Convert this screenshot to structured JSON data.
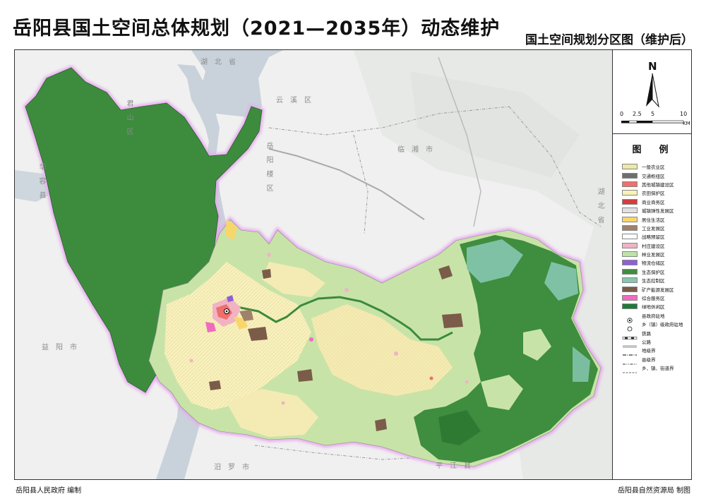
{
  "header": {
    "title": "岳阳县国土空间总体规划（2021—2035年）动态维护",
    "subtitle": "国土空间规划分区图（维护后）"
  },
  "map": {
    "place_labels": [
      "湖　北　省",
      "君　山　区",
      "华　容　县",
      "云　溪　区",
      "岳　阳　楼　区",
      "临　湘　市",
      "湖　北　省",
      "益　阳　市",
      "汨　罗　市",
      "平　江　县"
    ],
    "colors": {
      "water": "#c9d2da",
      "basemap": "#f0f0f0",
      "eco_protection": "#3d8c3e",
      "forest": "#c8e3a8",
      "farmland": "#f7f1bf"
    }
  },
  "compass": {
    "north_label": "N",
    "scale_ticks": [
      "0",
      "2.5",
      "5",
      "10"
    ],
    "scale_unit": "KM"
  },
  "legend": {
    "title": "图　例",
    "zones": [
      {
        "label": "一般农业区",
        "color": "#ede8a8"
      },
      {
        "label": "交通枢纽区",
        "color": "#6e6e6e"
      },
      {
        "label": "其他城镇建设区",
        "color": "#ef6f6c"
      },
      {
        "label": "农田保护区",
        "color": "#f9f3b5"
      },
      {
        "label": "商业商务区",
        "color": "#d63c3c"
      },
      {
        "label": "城镇弹性发展区",
        "color": "#e0e0e0"
      },
      {
        "label": "居住生活区",
        "color": "#f7d76b"
      },
      {
        "label": "工业发展区",
        "color": "#a0826a"
      },
      {
        "label": "战略预留区",
        "color": "#ffffff"
      },
      {
        "label": "村庄建设区",
        "color": "#f1b3c4"
      },
      {
        "label": "林业发展区",
        "color": "#bfe2a7"
      },
      {
        "label": "物流仓储区",
        "color": "#8f5fd6"
      },
      {
        "label": "生态保护区",
        "color": "#3f8d3f"
      },
      {
        "label": "生态控制区",
        "color": "#86c7b0"
      },
      {
        "label": "矿产能源发展区",
        "color": "#7a5c49"
      },
      {
        "label": "综合服务区",
        "color": "#f06bc0"
      },
      {
        "label": "绿地休闲区",
        "color": "#1f7a3a"
      }
    ],
    "symbols": [
      {
        "label": "县政府驻地",
        "type": "county-seat"
      },
      {
        "label": "乡（镇）级政府驻地",
        "type": "town-seat"
      },
      {
        "label": "铁路",
        "type": "railway"
      },
      {
        "label": "公路",
        "type": "road"
      },
      {
        "label": "地级界",
        "type": "prefecture-boundary"
      },
      {
        "label": "县级界",
        "type": "county-boundary"
      },
      {
        "label": "乡、镇、街道界",
        "type": "township-boundary"
      }
    ]
  },
  "footer": {
    "left": "岳阳县人民政府 编制",
    "right": "岳阳县自然资源局 制图"
  }
}
